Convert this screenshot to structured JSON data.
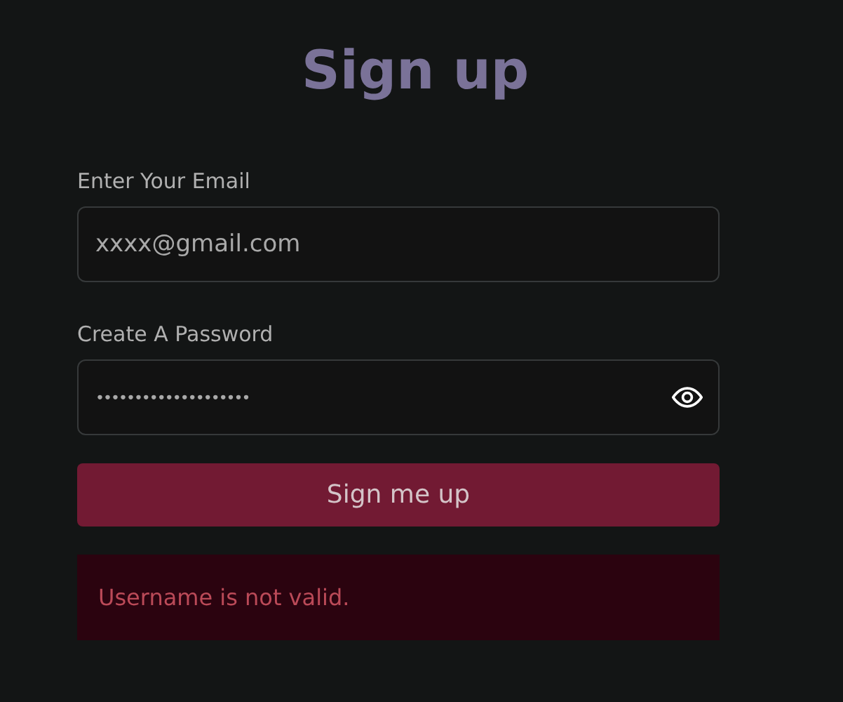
{
  "title": "Sign up",
  "fields": [
    {
      "label": "Enter Your Email",
      "value": "xxxx@gmail.com",
      "kind": "text"
    },
    {
      "label": "Create A Password",
      "value": "••••••••••••••••••••",
      "kind": "password"
    }
  ],
  "submit": "Sign me up",
  "error": "Username is not valid."
}
